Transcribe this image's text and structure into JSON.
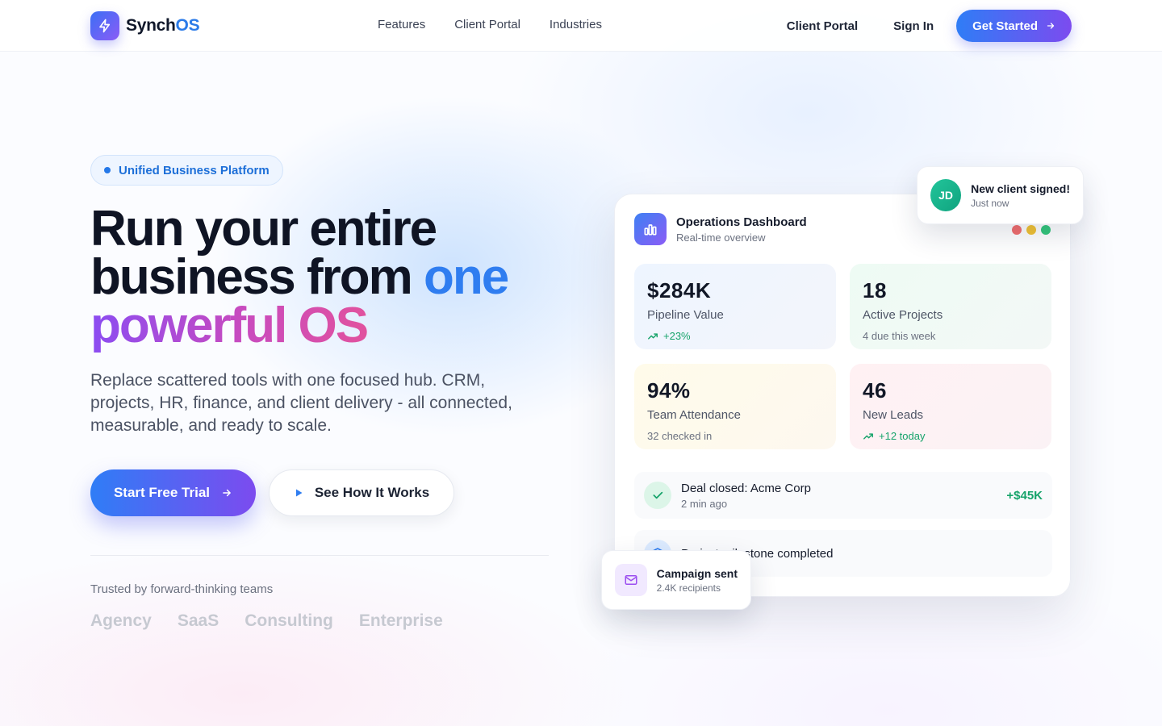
{
  "brand": {
    "name_prefix": "Synch",
    "name_suffix": "OS"
  },
  "nav": {
    "items": [
      "Features",
      "Client Portal",
      "Industries"
    ]
  },
  "header_actions": {
    "client_portal": "Client Portal",
    "sign_in": "Sign In",
    "get_started": "Get Started"
  },
  "hero": {
    "badge": "Unified Business Platform",
    "headline_line1": "Run your entire",
    "headline_line2_a": "business from ",
    "headline_line2_b": "one",
    "headline_line3": "powerful OS",
    "subtitle": "Replace scattered tools with one focused hub. CRM, projects, HR, finance, and client delivery - all connected, measurable, and ready to scale.",
    "primary_cta": "Start Free Trial",
    "secondary_cta": "See How It Works",
    "trusted_label": "Trusted by forward-thinking teams",
    "trusted_logos": [
      "Agency",
      "SaaS",
      "Consulting",
      "Enterprise"
    ]
  },
  "dashboard": {
    "title": "Operations Dashboard",
    "subtitle": "Real-time overview",
    "stats": [
      {
        "value": "$284K",
        "label": "Pipeline Value",
        "note": "+23%"
      },
      {
        "value": "18",
        "label": "Active Projects",
        "note": "4 due this week"
      },
      {
        "value": "94%",
        "label": "Team Attendance",
        "note": "32 checked in"
      },
      {
        "value": "46",
        "label": "New Leads",
        "note": "+12 today"
      }
    ],
    "activity": [
      {
        "title": "Deal closed: Acme Corp",
        "time": "2 min ago",
        "amount": "+$45K"
      },
      {
        "title": "Project milestone completed"
      }
    ]
  },
  "notifications": {
    "client": {
      "initials": "JD",
      "title": "New client signed!",
      "time": "Just now"
    },
    "campaign": {
      "title": "Campaign sent",
      "subtitle": "2.4K recipients"
    }
  },
  "colors": {
    "accent_blue": "#2f7df6",
    "accent_purple": "#7c4bef",
    "success": "#16a36a"
  }
}
